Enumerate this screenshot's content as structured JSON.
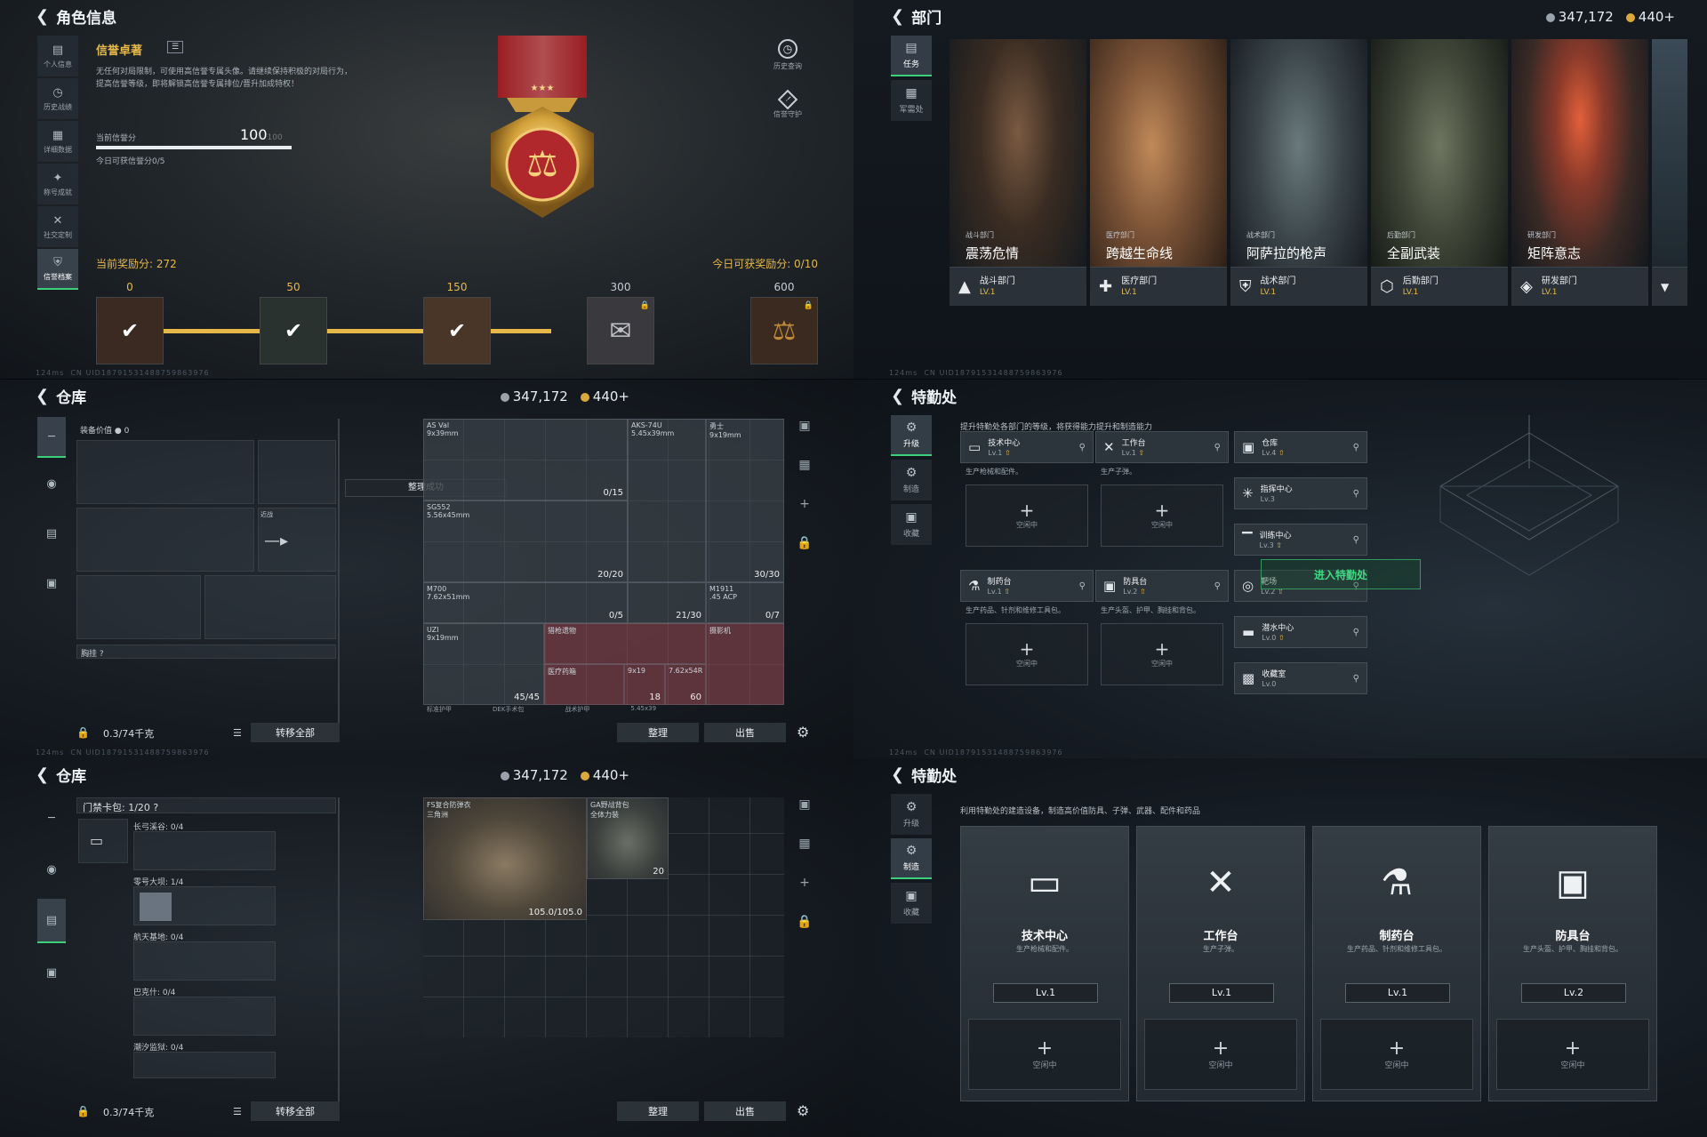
{
  "currency": {
    "silver": "347,172",
    "gold": "440+"
  },
  "footer_ping": "124ms",
  "footer_uid": "CN UID18791531488759863976",
  "p1": {
    "title": "角色信息",
    "nav": [
      {
        "label": "个人信息",
        "icon": "stats-icon"
      },
      {
        "label": "历史战绩",
        "icon": "history-icon"
      },
      {
        "label": "详细数据",
        "icon": "data-icon"
      },
      {
        "label": "称号成就",
        "icon": "achievement-icon"
      },
      {
        "label": "社交定制",
        "icon": "tools-icon"
      },
      {
        "label": "信誉档案",
        "icon": "shield-icon"
      }
    ],
    "honor_title": "信誉卓著",
    "honor_desc": "无任何对局限制，可使用高信誉专属头像。请继续保持积极的对局行为，提高信誉等级，即将解锁高信誉专属排位/晋升加成特权！",
    "score_label": "当前信誉分",
    "score_value": "100",
    "score_max": "100",
    "score_fill": 1.0,
    "today_score": "今日可获信誉分0/5",
    "history_query": "历史查询",
    "credit_guard": "信誉守护",
    "reward_current": "当前奖励分: 272",
    "reward_today": "今日可获奖励分: 0/10",
    "milestones": [
      {
        "value": "0",
        "state": "claimed"
      },
      {
        "value": "50",
        "state": "claimed"
      },
      {
        "value": "150",
        "state": "claimed"
      },
      {
        "value": "300",
        "state": "locked"
      },
      {
        "value": "600",
        "state": "locked"
      }
    ]
  },
  "p2": {
    "title": "部门",
    "tabs": [
      {
        "label": "任务"
      },
      {
        "label": "军需处"
      }
    ],
    "departments": [
      {
        "sub": "战斗部门",
        "name": "震荡危情",
        "bar_label": "战斗部门",
        "lv": "LV.1",
        "color": "#5a4a3a"
      },
      {
        "sub": "医疗部门",
        "name": "跨越生命线",
        "bar_label": "医疗部门",
        "lv": "LV.1",
        "color": "#8a6040"
      },
      {
        "sub": "战术部门",
        "name": "阿萨拉的枪声",
        "bar_label": "战术部门",
        "lv": "LV.1",
        "color": "#3e4a4e"
      },
      {
        "sub": "后勤部门",
        "name": "全副武装",
        "bar_label": "后勤部门",
        "lv": "LV.1",
        "color": "#4a5040"
      },
      {
        "sub": "研发部门",
        "name": "矩阵意志",
        "bar_label": "研发部门",
        "lv": "LV.1",
        "color": "#6a3a30"
      }
    ]
  },
  "p3": {
    "title": "仓库",
    "equip_value": "装备价值",
    "equip_value_num": "0",
    "knife_label": "近战",
    "chest_label": "胸挂",
    "toast": "整理成功",
    "capacity": "0.3/74千克",
    "transfer_all": "转移全部",
    "sort": "整理",
    "sell": "出售",
    "items": [
      {
        "name": "AS Val",
        "cal": "9x39mm",
        "count": "0/15"
      },
      {
        "name": "AKS-74U",
        "cal": "5.45x39mm",
        "count": ""
      },
      {
        "name": "勇士",
        "cal": "9x19mm",
        "count": "30/30"
      },
      {
        "name": "SG552",
        "cal": "5.56x45mm",
        "count": "20/20"
      },
      {
        "name": "M700",
        "cal": "7.62x51mm",
        "count": "0/5"
      },
      {
        "name": "",
        "cal": "",
        "count": "21/30"
      },
      {
        "name": "M1911",
        "cal": ".45 ACP",
        "count": "0/7"
      },
      {
        "name": "UZI",
        "cal": "9x19mm",
        "count": "45/45"
      },
      {
        "name": "猎枪遗物",
        "cal": "",
        "count": ""
      },
      {
        "name": "摄影机",
        "cal": "",
        "count": ""
      },
      {
        "name": "医疗药箱",
        "cal": "",
        "count": ""
      },
      {
        "name": "9x19",
        "cal": "",
        "count": "18"
      },
      {
        "name": "7.62x54R",
        "cal": "",
        "count": "60"
      }
    ],
    "bottom_row": [
      "标准护甲",
      "DEK手术包",
      "战术护甲",
      "5.45x39"
    ]
  },
  "p4": {
    "title": "特勤处",
    "tabs": [
      {
        "label": "升级",
        "badge": "!"
      },
      {
        "label": "制造"
      },
      {
        "label": "收藏"
      }
    ],
    "desc": "提升特勤处各部门的等级，将获得能力提升和制造能力",
    "facilities": [
      {
        "name": "技术中心",
        "lv": "Lv.1",
        "desc": "生产枪械和配件。"
      },
      {
        "name": "工作台",
        "lv": "Lv.1",
        "desc": "生产子弹。"
      },
      {
        "name": "制药台",
        "lv": "Lv.1",
        "desc": "生产药品、针剂和维修工具包。"
      },
      {
        "name": "防具台",
        "lv": "Lv.2",
        "desc": "生产头盔、护甲、胸挂和背包。"
      }
    ],
    "right_list": [
      {
        "name": "仓库",
        "lv": "Lv.4"
      },
      {
        "name": "指挥中心",
        "lv": "Lv.3"
      },
      {
        "name": "训练中心",
        "lv": "Lv.3"
      },
      {
        "name": "靶场",
        "lv": "Lv.2"
      },
      {
        "name": "潜水中心",
        "lv": "Lv.0"
      },
      {
        "name": "收藏室",
        "lv": "Lv.0"
      }
    ],
    "idle": "空闲中",
    "enter": "进入特勤处"
  },
  "p5": {
    "title": "仓库",
    "keycard": "门禁卡包: 1/20",
    "pockets": [
      {
        "label": "长弓溪谷: 0/4"
      },
      {
        "label": "零号大坝: 1/4"
      },
      {
        "label": "航天基地: 0/4"
      },
      {
        "label": "巴克什: 0/4"
      },
      {
        "label": "潮汐监狱: 0/4"
      }
    ],
    "items": [
      {
        "name": "FS复合防弹衣",
        "sub": "三角洲",
        "count": "105.0/105.0"
      },
      {
        "name": "GA野战背包",
        "sub": "全体力装",
        "count": "20"
      }
    ],
    "capacity": "0.3/74千克",
    "transfer_all": "转移全部",
    "sort": "整理",
    "sell": "出售"
  },
  "p6": {
    "title": "特勤处",
    "tabs": [
      {
        "label": "升级",
        "badge": "!"
      },
      {
        "label": "制造"
      },
      {
        "label": "收藏"
      }
    ],
    "desc": "利用特勤处的建造设备，制造高价值防具、子弹、武器、配件和药品",
    "cards": [
      {
        "name": "技术中心",
        "desc": "生产枪械和配件。",
        "lv": "Lv.1",
        "icon": "computer-icon"
      },
      {
        "name": "工作台",
        "desc": "生产子弹。",
        "lv": "Lv.1",
        "icon": "tools-icon"
      },
      {
        "name": "制药台",
        "desc": "生产药品、针剂和维修工具包。",
        "lv": "Lv.1",
        "icon": "microscope-icon"
      },
      {
        "name": "防具台",
        "desc": "生产头盔、护甲、胸挂和背包。",
        "lv": "Lv.2",
        "icon": "boxes-icon"
      }
    ],
    "idle": "空闲中"
  }
}
